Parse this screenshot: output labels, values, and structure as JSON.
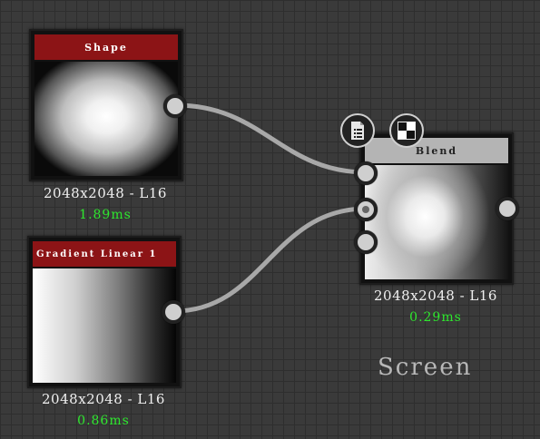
{
  "nodes": {
    "shape": {
      "title": "Shape",
      "resolution": "2048x2048 - L16",
      "time": "1.89ms"
    },
    "gradient": {
      "title": "Gradient Linear 1",
      "resolution": "2048x2048 - L16",
      "time": "0.86ms"
    },
    "blend": {
      "title": "Blend",
      "resolution": "2048x2048 - L16",
      "time": "0.29ms",
      "mode": "Screen"
    }
  },
  "icons": {
    "doc": "document-list-icon",
    "checker": "checker-icon"
  },
  "colors": {
    "title_red": "#8c1416",
    "time_green": "#2ee82e",
    "wire": "#a8a8a8"
  }
}
